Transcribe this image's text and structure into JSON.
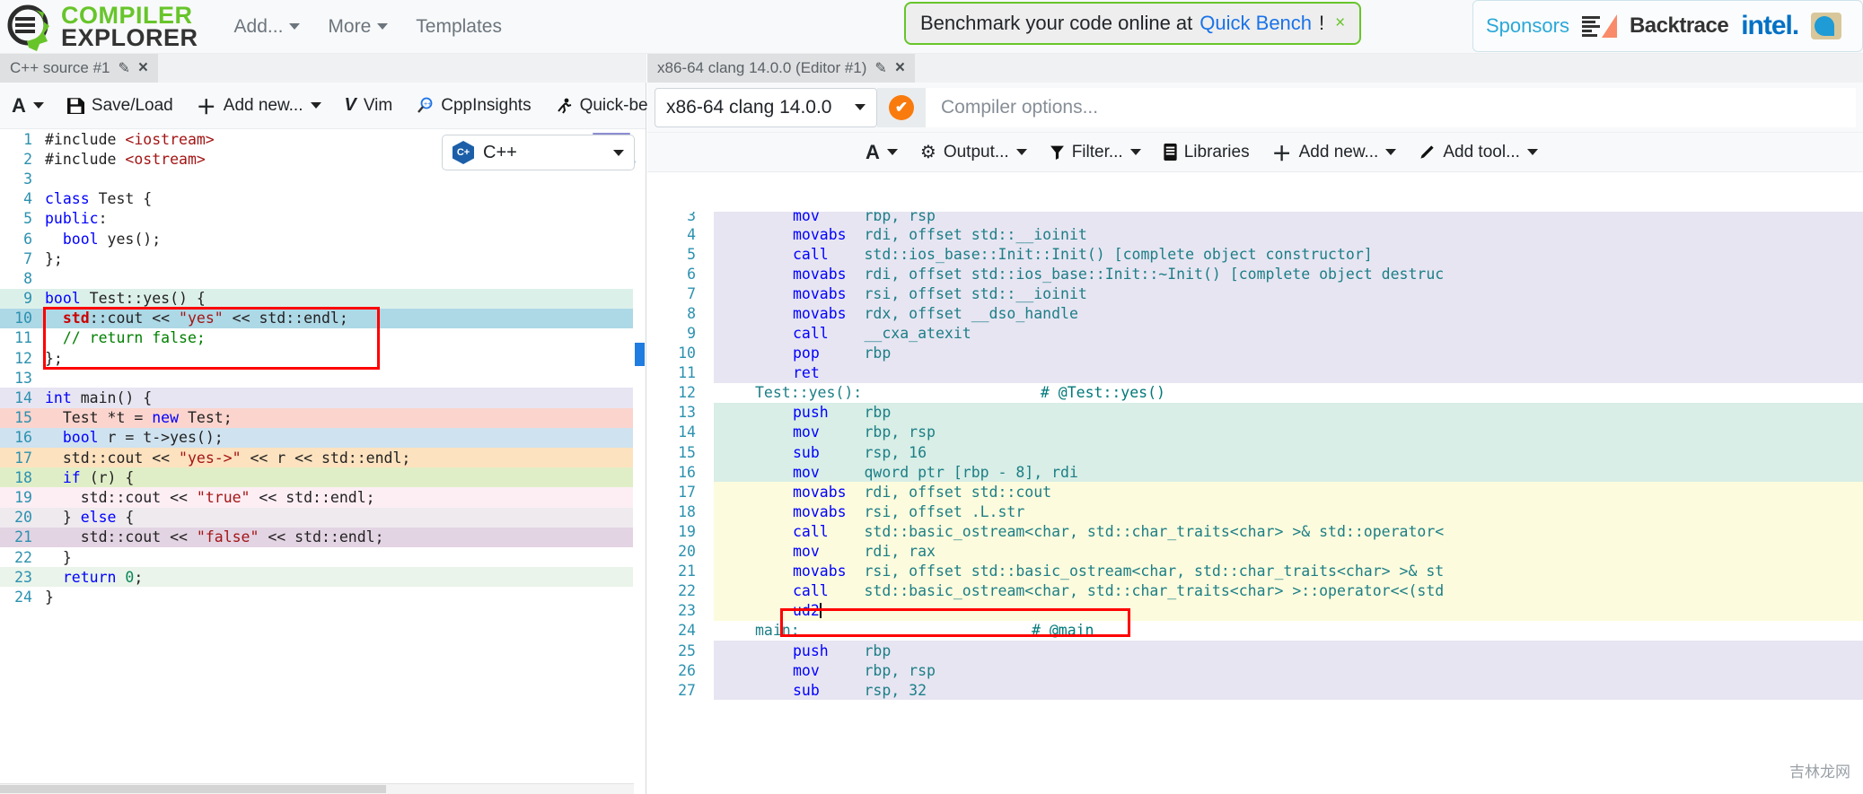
{
  "navbar": {
    "brand_line1": "COMPILER",
    "brand_line2": "EXPLORER",
    "brand_color": "#67c52a",
    "links": [
      {
        "label": "Add...",
        "has_caret": true
      },
      {
        "label": "More",
        "has_caret": true
      },
      {
        "label": "Templates",
        "has_caret": false
      }
    ],
    "banner": {
      "text": "Benchmark your code online at",
      "link": "Quick Bench",
      "suffix": "!",
      "close": "×",
      "border_color": "#67c52a",
      "link_color": "#1a73e8"
    },
    "sponsors": {
      "label": "Sponsors",
      "items": [
        "Backtrace",
        "intel."
      ],
      "label_color": "#2aa8d8",
      "intel_color": "#0071c5"
    }
  },
  "editor_pane": {
    "tab": {
      "title": "C++ source #1",
      "edit_icon": "pencil-icon",
      "close_icon": "×"
    },
    "pane_controls": {
      "maximize": "❐",
      "close": "✕"
    },
    "toolbar": [
      {
        "icon": "font-size-icon",
        "glyph": "A",
        "label": "",
        "caret": true
      },
      {
        "icon": "save-icon",
        "glyph": "💾",
        "label": "Save/Load",
        "caret": false
      },
      {
        "icon": "plus-icon",
        "glyph": "＋",
        "label": "Add new...",
        "caret": true
      },
      {
        "icon": "vim-icon",
        "glyph": "V",
        "label": "Vim",
        "caret": false
      },
      {
        "icon": "cppinsights-icon",
        "glyph": "🔍",
        "label": "CppInsights",
        "caret": false
      },
      {
        "icon": "quickbench-icon",
        "glyph": "🏃",
        "label": "Quick-bench",
        "caret": false
      }
    ],
    "language_select": {
      "value": "C++",
      "icon": "cpp-logo-icon"
    },
    "code_lines": [
      {
        "n": "1",
        "bg": "",
        "tokens": [
          [
            "pre",
            "#include "
          ],
          [
            "str",
            "<iostream>"
          ]
        ]
      },
      {
        "n": "2",
        "bg": "",
        "tokens": [
          [
            "pre",
            "#include "
          ],
          [
            "str",
            "<ostream>"
          ]
        ]
      },
      {
        "n": "3",
        "bg": "",
        "tokens": [
          [
            "pre",
            ""
          ]
        ]
      },
      {
        "n": "4",
        "bg": "",
        "tokens": [
          [
            "k",
            "class "
          ],
          [
            "pl",
            "Test {"
          ]
        ]
      },
      {
        "n": "5",
        "bg": "",
        "tokens": [
          [
            "k",
            "public"
          ],
          [
            "pl",
            ":"
          ]
        ]
      },
      {
        "n": "6",
        "bg": "",
        "tokens": [
          [
            "pl",
            "  "
          ],
          [
            "k",
            "bool "
          ],
          [
            "pl",
            "yes();"
          ]
        ]
      },
      {
        "n": "7",
        "bg": "",
        "tokens": [
          [
            "pl",
            "};"
          ]
        ]
      },
      {
        "n": "8",
        "bg": "",
        "tokens": [
          [
            "pl",
            ""
          ]
        ]
      },
      {
        "n": "9",
        "bg": "#dcf0ea",
        "tokens": [
          [
            "k",
            "bool "
          ],
          [
            "pl",
            "Test::yes() {"
          ]
        ]
      },
      {
        "n": "10",
        "bg": "#add8e6",
        "tokens": [
          [
            "pl",
            "  "
          ],
          [
            "id-std",
            "std"
          ],
          [
            "pl",
            "::cout << "
          ],
          [
            "str",
            "\"yes\""
          ],
          [
            "pl",
            " << std::endl;"
          ]
        ]
      },
      {
        "n": "11",
        "bg": "#ffffff",
        "tokens": [
          [
            "pl",
            "  "
          ],
          [
            "cm",
            "// return false;"
          ]
        ]
      },
      {
        "n": "12",
        "bg": "#ffffff",
        "tokens": [
          [
            "pl",
            "};"
          ]
        ]
      },
      {
        "n": "13",
        "bg": "",
        "tokens": [
          [
            "pl",
            ""
          ]
        ]
      },
      {
        "n": "14",
        "bg": "#e7e5f2",
        "tokens": [
          [
            "k",
            "int "
          ],
          [
            "pl",
            "main() {"
          ]
        ]
      },
      {
        "n": "15",
        "bg": "#fbd4cd",
        "tokens": [
          [
            "pl",
            "  Test *t = "
          ],
          [
            "k",
            "new "
          ],
          [
            "pl",
            "Test;"
          ]
        ]
      },
      {
        "n": "16",
        "bg": "#cfe2ef",
        "tokens": [
          [
            "pl",
            "  "
          ],
          [
            "k",
            "bool "
          ],
          [
            "pl",
            "r = t->yes();"
          ]
        ]
      },
      {
        "n": "17",
        "bg": "#fde2bf",
        "tokens": [
          [
            "pl",
            "  std::cout << "
          ],
          [
            "str",
            "\"yes->\""
          ],
          [
            "pl",
            " << r << std::endl;"
          ]
        ]
      },
      {
        "n": "18",
        "bg": "#e0eec7",
        "tokens": [
          [
            "pl",
            "  "
          ],
          [
            "k",
            "if "
          ],
          [
            "pl",
            "(r) {"
          ]
        ]
      },
      {
        "n": "19",
        "bg": "#fdeef4",
        "tokens": [
          [
            "pl",
            "    std::cout << "
          ],
          [
            "str",
            "\"true\""
          ],
          [
            "pl",
            " << std::endl;"
          ]
        ]
      },
      {
        "n": "20",
        "bg": "#eeeaee",
        "tokens": [
          [
            "pl",
            "  } "
          ],
          [
            "k",
            "else "
          ],
          [
            "pl",
            "{"
          ]
        ]
      },
      {
        "n": "21",
        "bg": "#e3d4e3",
        "tokens": [
          [
            "pl",
            "    std::cout << "
          ],
          [
            "str",
            "\"false\""
          ],
          [
            "pl",
            " << std::endl;"
          ]
        ]
      },
      {
        "n": "22",
        "bg": "#ffffff",
        "tokens": [
          [
            "pl",
            "  }"
          ]
        ]
      },
      {
        "n": "23",
        "bg": "#eaf4ea",
        "tokens": [
          [
            "pl",
            "  "
          ],
          [
            "k",
            "return "
          ],
          [
            "num",
            "0"
          ],
          [
            "pl",
            ";"
          ]
        ]
      },
      {
        "n": "24",
        "bg": "",
        "tokens": [
          [
            "pl",
            "}"
          ]
        ]
      }
    ],
    "annotation_box": {
      "from_line": "10",
      "to_line": "12",
      "color": "#ff0000"
    }
  },
  "asm_pane": {
    "tab": {
      "title": "x86-64 clang 14.0.0 (Editor #1)",
      "edit_icon": "pencil-icon",
      "close_icon": "×"
    },
    "compiler_select": {
      "value": "x86-64 clang 14.0.0"
    },
    "status": {
      "icon": "check-circle-icon",
      "glyph": "✔",
      "color": "#f97b0d"
    },
    "options_input": {
      "value": "",
      "placeholder": "Compiler options..."
    },
    "toolbar": [
      {
        "icon": "font-size-icon",
        "glyph": "A",
        "label": "",
        "caret": true
      },
      {
        "icon": "gear-icon",
        "glyph": "⚙",
        "label": "Output...",
        "caret": true
      },
      {
        "icon": "filter-icon",
        "glyph": "▼",
        "label": "Filter...",
        "caret": true
      },
      {
        "icon": "libraries-icon",
        "glyph": "☰",
        "label": "Libraries",
        "caret": false
      },
      {
        "icon": "plus-icon",
        "glyph": "＋",
        "label": "Add new...",
        "caret": true
      },
      {
        "icon": "tool-icon",
        "glyph": "✐",
        "label": "Add tool...",
        "caret": true
      }
    ],
    "asm_lines": [
      {
        "n": "3",
        "bg": "#e7e5f2",
        "clip": true,
        "tokens": [
          [
            "mn",
            "mov"
          ],
          [
            "pad",
            "     "
          ],
          [
            "op",
            "rbp, rsp"
          ]
        ]
      },
      {
        "n": "4",
        "bg": "#e7e5f2",
        "tokens": [
          [
            "mn",
            "movabs"
          ],
          [
            "pad",
            "  "
          ],
          [
            "op",
            "rdi, offset std::__ioinit"
          ]
        ]
      },
      {
        "n": "5",
        "bg": "#e7e5f2",
        "tokens": [
          [
            "mn",
            "call"
          ],
          [
            "pad",
            "    "
          ],
          [
            "op",
            "std::ios_base::Init::Init() [complete object constructor]"
          ]
        ]
      },
      {
        "n": "6",
        "bg": "#e7e5f2",
        "tokens": [
          [
            "mn",
            "movabs"
          ],
          [
            "pad",
            "  "
          ],
          [
            "op",
            "rdi, offset std::ios_base::Init::~Init() [complete object destruc"
          ]
        ]
      },
      {
        "n": "7",
        "bg": "#e7e5f2",
        "tokens": [
          [
            "mn",
            "movabs"
          ],
          [
            "pad",
            "  "
          ],
          [
            "op",
            "rsi, offset std::__ioinit"
          ]
        ]
      },
      {
        "n": "8",
        "bg": "#e7e5f2",
        "tokens": [
          [
            "mn",
            "movabs"
          ],
          [
            "pad",
            "  "
          ],
          [
            "op",
            "rdx, offset __dso_handle"
          ]
        ]
      },
      {
        "n": "9",
        "bg": "#e7e5f2",
        "tokens": [
          [
            "mn",
            "call"
          ],
          [
            "pad",
            "    "
          ],
          [
            "op",
            "__cxa_atexit"
          ]
        ]
      },
      {
        "n": "10",
        "bg": "#e7e5f2",
        "tokens": [
          [
            "mn",
            "pop"
          ],
          [
            "pad",
            "     "
          ],
          [
            "op",
            "rbp"
          ]
        ]
      },
      {
        "n": "11",
        "bg": "#e7e5f2",
        "tokens": [
          [
            "mn",
            "ret"
          ]
        ]
      },
      {
        "n": "12",
        "bg": "",
        "label": true,
        "tokens": [
          [
            "lbl",
            "Test::yes():"
          ],
          [
            "pad",
            "                    "
          ],
          [
            "cmt",
            "# @Test::yes()"
          ]
        ]
      },
      {
        "n": "13",
        "bg": "#d8eee6",
        "tokens": [
          [
            "mn",
            "push"
          ],
          [
            "pad",
            "    "
          ],
          [
            "op",
            "rbp"
          ]
        ]
      },
      {
        "n": "14",
        "bg": "#d8eee6",
        "tokens": [
          [
            "mn",
            "mov"
          ],
          [
            "pad",
            "     "
          ],
          [
            "op",
            "rbp, rsp"
          ]
        ]
      },
      {
        "n": "15",
        "bg": "#d8eee6",
        "tokens": [
          [
            "mn",
            "sub"
          ],
          [
            "pad",
            "     "
          ],
          [
            "op",
            "rsp, 16"
          ]
        ]
      },
      {
        "n": "16",
        "bg": "#d8eee6",
        "tokens": [
          [
            "mn",
            "mov"
          ],
          [
            "pad",
            "     "
          ],
          [
            "op",
            "qword ptr [rbp - 8], rdi"
          ]
        ]
      },
      {
        "n": "17",
        "bg": "#fcfbdd",
        "marker": true,
        "tokens": [
          [
            "mn",
            "movabs"
          ],
          [
            "pad",
            "  "
          ],
          [
            "op",
            "rdi, offset std::cout"
          ]
        ]
      },
      {
        "n": "18",
        "bg": "#fcfbdd",
        "marker": true,
        "tokens": [
          [
            "mn",
            "movabs"
          ],
          [
            "pad",
            "  "
          ],
          [
            "op",
            "rsi, offset .L.str"
          ]
        ]
      },
      {
        "n": "19",
        "bg": "#fcfbdd",
        "marker": true,
        "tokens": [
          [
            "mn",
            "call"
          ],
          [
            "pad",
            "    "
          ],
          [
            "op",
            "std::basic_ostream<char, std::char_traits<char> >& std::operator<"
          ]
        ]
      },
      {
        "n": "20",
        "bg": "#fcfbdd",
        "marker": true,
        "tokens": [
          [
            "mn",
            "mov"
          ],
          [
            "pad",
            "     "
          ],
          [
            "op",
            "rdi, rax"
          ]
        ]
      },
      {
        "n": "21",
        "bg": "#fcfbdd",
        "marker": true,
        "tokens": [
          [
            "mn",
            "movabs"
          ],
          [
            "pad",
            "  "
          ],
          [
            "op",
            "rsi, offset std::basic_ostream<char, std::char_traits<char> >& st"
          ]
        ]
      },
      {
        "n": "22",
        "bg": "#fcfbdd",
        "marker": true,
        "tokens": [
          [
            "mn",
            "call"
          ],
          [
            "pad",
            "    "
          ],
          [
            "op",
            "std::basic_ostream<char, std::char_traits<char> >::operator<<(std"
          ]
        ]
      },
      {
        "n": "23",
        "bg": "#fcfbdd",
        "marker": true,
        "caret": true,
        "tokens": [
          [
            "mn",
            "ud2"
          ]
        ]
      },
      {
        "n": "24",
        "bg": "",
        "label": true,
        "tokens": [
          [
            "lbl",
            "main:"
          ],
          [
            "pad",
            "                          "
          ],
          [
            "cmt",
            "# @main"
          ]
        ]
      },
      {
        "n": "25",
        "bg": "#e7e5f2",
        "tokens": [
          [
            "mn",
            "push"
          ],
          [
            "pad",
            "    "
          ],
          [
            "op",
            "rbp"
          ]
        ]
      },
      {
        "n": "26",
        "bg": "#e7e5f2",
        "tokens": [
          [
            "mn",
            "mov"
          ],
          [
            "pad",
            "     "
          ],
          [
            "op",
            "rbp, rsp"
          ]
        ]
      },
      {
        "n": "27",
        "bg": "#e7e5f2",
        "tokens": [
          [
            "mn",
            "sub"
          ],
          [
            "pad",
            "     "
          ],
          [
            "op",
            "rsp, 32"
          ]
        ]
      }
    ],
    "annotation_box": {
      "line": "23",
      "color": "#ff0000"
    }
  },
  "watermark": {
    "text": "吉林龙网"
  }
}
